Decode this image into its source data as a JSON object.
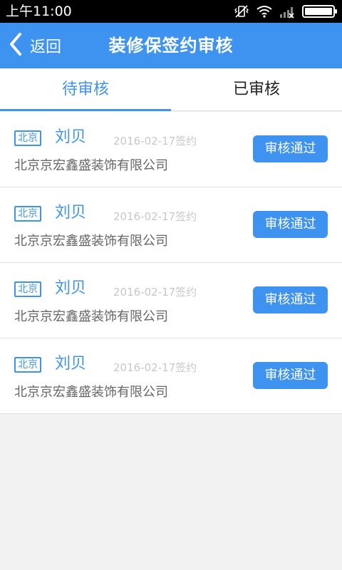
{
  "status_bar": {
    "time": "上午11:00",
    "icons": [
      "vibrate-icon",
      "wifi-icon",
      "signal-icon",
      "battery-icon"
    ]
  },
  "nav": {
    "back_label": "返回",
    "title": "装修保签约审核"
  },
  "tabs": [
    {
      "label": "待审核",
      "active": true
    },
    {
      "label": "已审核",
      "active": false
    }
  ],
  "items": [
    {
      "city": "北京",
      "name": "刘贝",
      "date": "2016-02-17签约",
      "company": "北京京宏鑫盛装饰有限公司",
      "action": "审核通过"
    },
    {
      "city": "北京",
      "name": "刘贝",
      "date": "2016-02-17签约",
      "company": "北京京宏鑫盛装饰有限公司",
      "action": "审核通过"
    },
    {
      "city": "北京",
      "name": "刘贝",
      "date": "2016-02-17签约",
      "company": "北京京宏鑫盛装饰有限公司",
      "action": "审核通过"
    },
    {
      "city": "北京",
      "name": "刘贝",
      "date": "2016-02-17签约",
      "company": "北京京宏鑫盛装饰有限公司",
      "action": "审核通过"
    }
  ],
  "colors": {
    "accent": "#3e93f1",
    "background": "#f2f2f2"
  }
}
